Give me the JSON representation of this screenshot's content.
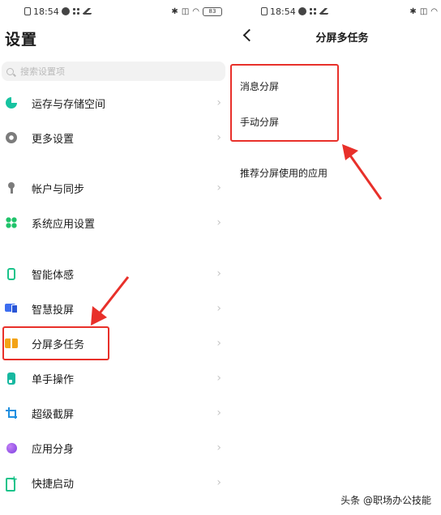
{
  "left_status": {
    "time": "18:54",
    "battery": "83"
  },
  "right_status": {
    "time": "18:54"
  },
  "settings": {
    "title": "设置",
    "search_placeholder": "搜索设置项",
    "items": [
      {
        "label": "运存与存储空间"
      },
      {
        "label": "更多设置"
      },
      {
        "label": "帐户与同步"
      },
      {
        "label": "系统应用设置"
      },
      {
        "label": "智能体感"
      },
      {
        "label": "智慧投屏"
      },
      {
        "label": "分屏多任务"
      },
      {
        "label": "单手操作"
      },
      {
        "label": "超级截屏"
      },
      {
        "label": "应用分身"
      },
      {
        "label": "快捷启动"
      }
    ],
    "chevron": "›"
  },
  "split_screen": {
    "title": "分屏多任务",
    "items": [
      {
        "label": "消息分屏"
      },
      {
        "label": "手动分屏"
      }
    ],
    "recommended": "推荐分屏使用的应用"
  },
  "footer": {
    "watermark": "头条 @职场办公技能"
  },
  "colors": {
    "highlight_red": "#e8302a"
  }
}
